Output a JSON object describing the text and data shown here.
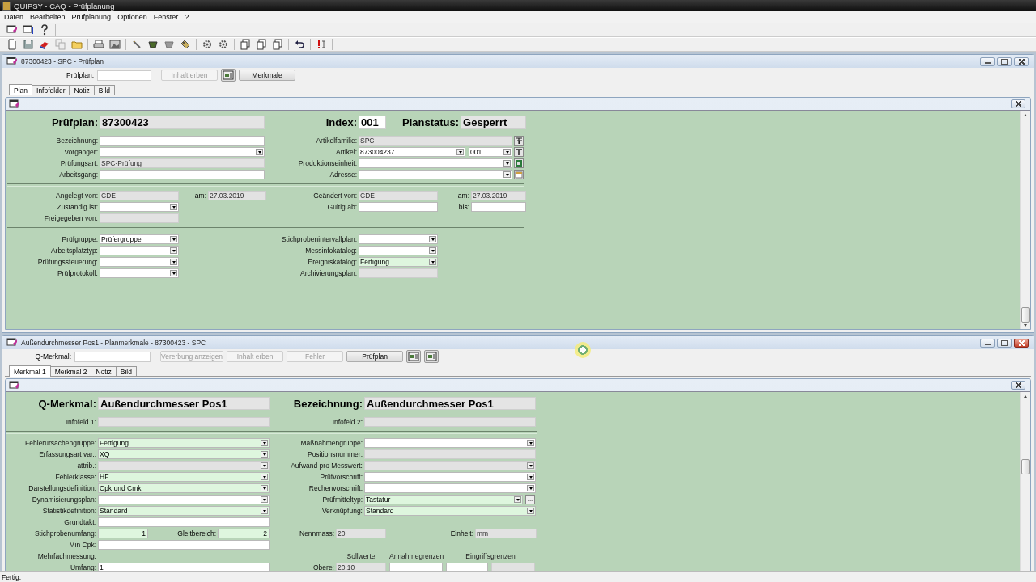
{
  "window": {
    "title": "QUIPSY - CAQ - Prüfplanung"
  },
  "menu": [
    "Daten",
    "Bearbeiten",
    "Prüfplanung",
    "Optionen",
    "Fenster",
    "?"
  ],
  "plan_window": {
    "title": "87300423 - SPC - Prüfplan",
    "active": false,
    "lookup": {
      "label": "Prüfplan:"
    },
    "buttons": [
      {
        "kind": "text",
        "label": "Inhalt erben",
        "disabled": true
      },
      {
        "kind": "icon",
        "disabled": false
      },
      {
        "kind": "text",
        "label": "Merkmale",
        "disabled": false
      }
    ],
    "tabs": [
      {
        "label": "Plan",
        "selected": true
      },
      {
        "label": "Infofelder",
        "selected": false
      },
      {
        "label": "Notiz",
        "selected": false
      },
      {
        "label": "Bild",
        "selected": false
      }
    ],
    "form": {
      "header": [
        {
          "label": "Prüfplan:",
          "value": "87300423",
          "readonly": true
        },
        {
          "label": "Index:",
          "value": "001",
          "readonly": false
        },
        {
          "label": "Planstatus:",
          "value": "Gesperrt",
          "readonly": true
        }
      ],
      "sections": [
        {
          "rows": [
            {
              "left": {
                "label": "Bezeichnung:",
                "kind": "text",
                "readonly": false,
                "required": false
              },
              "right": {
                "label": "Artikelfamilie:",
                "kind": "text",
                "readonly": true,
                "required": false,
                "value": "SPC",
                "tool": true
              }
            },
            {
              "left": {
                "label": "Vorgänger:",
                "kind": "combo",
                "readonly": false,
                "required": false
              },
              "right": {
                "label": "Artikel:",
                "kind": "combo",
                "readonly": false,
                "required": false,
                "value": "873004237",
                "sub": {
                  "kind": "combo",
                  "readonly": false,
                  "required": false,
                  "value": "001"
                },
                "tool": true
              }
            },
            {
              "left": {
                "label": "Prüfungsart:",
                "kind": "text",
                "readonly": true,
                "required": false,
                "value": "SPC-Prüfung"
              },
              "right": {
                "label": "Produktionseinheit:",
                "kind": "combo",
                "readonly": false,
                "required": false,
                "tool": true
              }
            },
            {
              "left": {
                "label": "Arbeitsgang:",
                "kind": "text",
                "readonly": false,
                "required": false
              },
              "right": {
                "label": "Adresse:",
                "kind": "combo",
                "readonly": false,
                "required": false,
                "tool": true
              }
            }
          ]
        },
        {
          "rows": [
            {
              "left": {
                "label": "Angelegt von:",
                "kind": "text",
                "readonly": true,
                "required": false,
                "value": "CDE",
                "pair": {
                  "label": "am:",
                  "kind": "text",
                  "readonly": true,
                  "required": false,
                  "value": "27.03.2019"
                }
              },
              "right": {
                "label": "Geändert von:",
                "kind": "text",
                "readonly": true,
                "required": false,
                "value": "CDE",
                "pair": {
                  "label": "am:",
                  "kind": "text",
                  "readonly": true,
                  "required": false,
                  "value": "27.03.2019"
                }
              }
            },
            {
              "left": {
                "label": "Zuständig ist:",
                "kind": "combo",
                "readonly": false,
                "required": false
              },
              "right": {
                "label": "Gültig ab:",
                "kind": "text",
                "readonly": false,
                "required": false,
                "pair": {
                  "label": "bis:",
                  "kind": "text",
                  "readonly": false,
                  "required": false
                }
              }
            },
            {
              "left": {
                "label": "Freigegeben von:",
                "kind": "text",
                "readonly": true,
                "required": false
              }
            }
          ]
        },
        {
          "rows": [
            {
              "left": {
                "label": "Prüfgruppe:",
                "kind": "combo",
                "readonly": false,
                "required": false,
                "value": "Prüfergruppe"
              },
              "right": {
                "label": "Stichprobenintervallplan:",
                "kind": "combo",
                "readonly": false,
                "required": false
              }
            },
            {
              "left": {
                "label": "Arbeitsplatztyp:",
                "kind": "combo",
                "readonly": false,
                "required": false
              },
              "right": {
                "label": "Messinfokatalog:",
                "kind": "combo",
                "readonly": false,
                "required": false
              }
            },
            {
              "left": {
                "label": "Prüfungssteuerung:",
                "kind": "combo",
                "readonly": false,
                "required": false
              },
              "right": {
                "label": "Ereigniskatalog:",
                "kind": "combo",
                "readonly": false,
                "required": true,
                "value": "Fertigung"
              }
            },
            {
              "left": {
                "label": "Prüfprotokoll:",
                "kind": "combo",
                "readonly": false,
                "required": false
              },
              "right": {
                "label": "Archivierungsplan:",
                "kind": "text",
                "readonly": true,
                "required": false
              }
            }
          ]
        }
      ]
    }
  },
  "feature_window": {
    "title": "Außendurchmesser Pos1 - Planmerkmale - 87300423 - SPC",
    "active": true,
    "lookup": {
      "label": "Q-Merkmal:"
    },
    "buttons": [
      {
        "kind": "text",
        "label": "Vererbung anzeigen",
        "disabled": true
      },
      {
        "kind": "text",
        "label": "Inhalt erben",
        "disabled": true
      },
      {
        "kind": "text",
        "label": "Fehler",
        "disabled": true
      },
      {
        "kind": "text",
        "label": "Prüfplan",
        "disabled": false
      },
      {
        "kind": "icon",
        "disabled": false
      },
      {
        "kind": "icon",
        "disabled": false
      }
    ],
    "tabs": [
      {
        "label": "Merkmal 1",
        "selected": true
      },
      {
        "label": "Merkmal 2",
        "selected": false
      },
      {
        "label": "Notiz",
        "selected": false
      },
      {
        "label": "Bild",
        "selected": false
      }
    ],
    "form": {
      "header": [
        {
          "label": "Q-Merkmal:",
          "value": "Außendurchmesser Pos1",
          "readonly": true
        },
        {
          "label": "Bezeichnung:",
          "value": "Außendurchmesser Pos1",
          "readonly": true
        }
      ],
      "sections": [
        {
          "rows": [
            {
              "left": {
                "label": "Infofeld 1:",
                "kind": "text",
                "readonly": true,
                "required": false
              },
              "right": {
                "label": "Infofeld 2:",
                "kind": "text",
                "readonly": true,
                "required": false
              }
            }
          ]
        },
        {
          "rows": [
            {
              "left": {
                "label": "Fehlerursachengruppe:",
                "kind": "combo",
                "readonly": false,
                "required": true,
                "value": "Fertigung"
              },
              "right": {
                "label": "Maßnahmengruppe:",
                "kind": "combo",
                "readonly": false,
                "required": false
              }
            },
            {
              "left": {
                "label": "Erfassungsart var.:",
                "kind": "combo",
                "readonly": false,
                "required": true,
                "value": "XQ"
              },
              "right": {
                "label": "Positionsnummer:",
                "kind": "text",
                "readonly": true,
                "required": false
              }
            },
            {
              "left": {
                "label": "attrib.:",
                "kind": "combo",
                "readonly": true,
                "required": false
              },
              "right": {
                "label": "Aufwand pro Messwert:",
                "kind": "combo",
                "readonly": true,
                "required": false
              }
            },
            {
              "left": {
                "label": "Fehlerklasse:",
                "kind": "combo",
                "readonly": false,
                "required": true,
                "value": "HF"
              },
              "right": {
                "label": "Prüfvorschrift:",
                "kind": "combo",
                "readonly": false,
                "required": false
              }
            },
            {
              "left": {
                "label": "Darstellungsdefinition:",
                "kind": "combo",
                "readonly": false,
                "required": true,
                "value": "Cpk und Cmk"
              },
              "right": {
                "label": "Rechenvorschrift:",
                "kind": "combo",
                "readonly": false,
                "required": false
              }
            },
            {
              "left": {
                "label": "Dynamisierungsplan:",
                "kind": "combo",
                "readonly": false,
                "required": false
              },
              "right": {
                "label": "Prüfmitteltyp:",
                "kind": "combo",
                "readonly": false,
                "required": true,
                "value": "Tastatur",
                "more": "..."
              }
            },
            {
              "left": {
                "label": "Statistikdefinition:",
                "kind": "combo",
                "readonly": false,
                "required": true,
                "value": "Standard"
              },
              "right": {
                "label": "Verknüpfung:",
                "kind": "combo",
                "readonly": false,
                "required": true,
                "value": "Standard"
              }
            },
            {
              "left": {
                "label": "Grundtakt:",
                "kind": "text",
                "readonly": false,
                "required": false
              }
            },
            {
              "left": {
                "label": "Stichprobenumfang:",
                "kind": "number",
                "readonly": false,
                "required": true,
                "value": "1",
                "pair": {
                  "label": "Gleitbereich:",
                  "kind": "number",
                  "readonly": false,
                  "required": true,
                  "value": "2"
                }
              },
              "right": {
                "label": "Nennmass:",
                "kind": "text",
                "readonly": true,
                "required": false,
                "value": "20",
                "pair": {
                  "label": "Einheit:",
                  "kind": "text",
                  "readonly": true,
                  "required": false,
                  "value": "mm"
                }
              }
            },
            {
              "left": {
                "label": "Min Cpk:",
                "kind": "text",
                "readonly": false,
                "required": false
              }
            },
            {
              "left": {
                "label": "Mehrfachmessung:",
                "kind": "caption"
              },
              "right": {
                "kind": "limits_header",
                "labels": [
                  "Sollwerte",
                  "Annahmegrenzen",
                  "Eingriffsgrenzen"
                ]
              }
            },
            {
              "left": {
                "label": "Umfang:",
                "kind": "text",
                "readonly": false,
                "required": false,
                "value": "1"
              },
              "right": {
                "kind": "limits",
                "label": "Obere:",
                "cells": [
                  {
                    "readonly": true,
                    "value": "20.10"
                  },
                  {
                    "readonly": false
                  },
                  {
                    "readonly": false
                  },
                  {
                    "readonly": true
                  }
                ]
              }
            }
          ]
        }
      ]
    }
  },
  "status_bar": {
    "text": "Fertig."
  }
}
